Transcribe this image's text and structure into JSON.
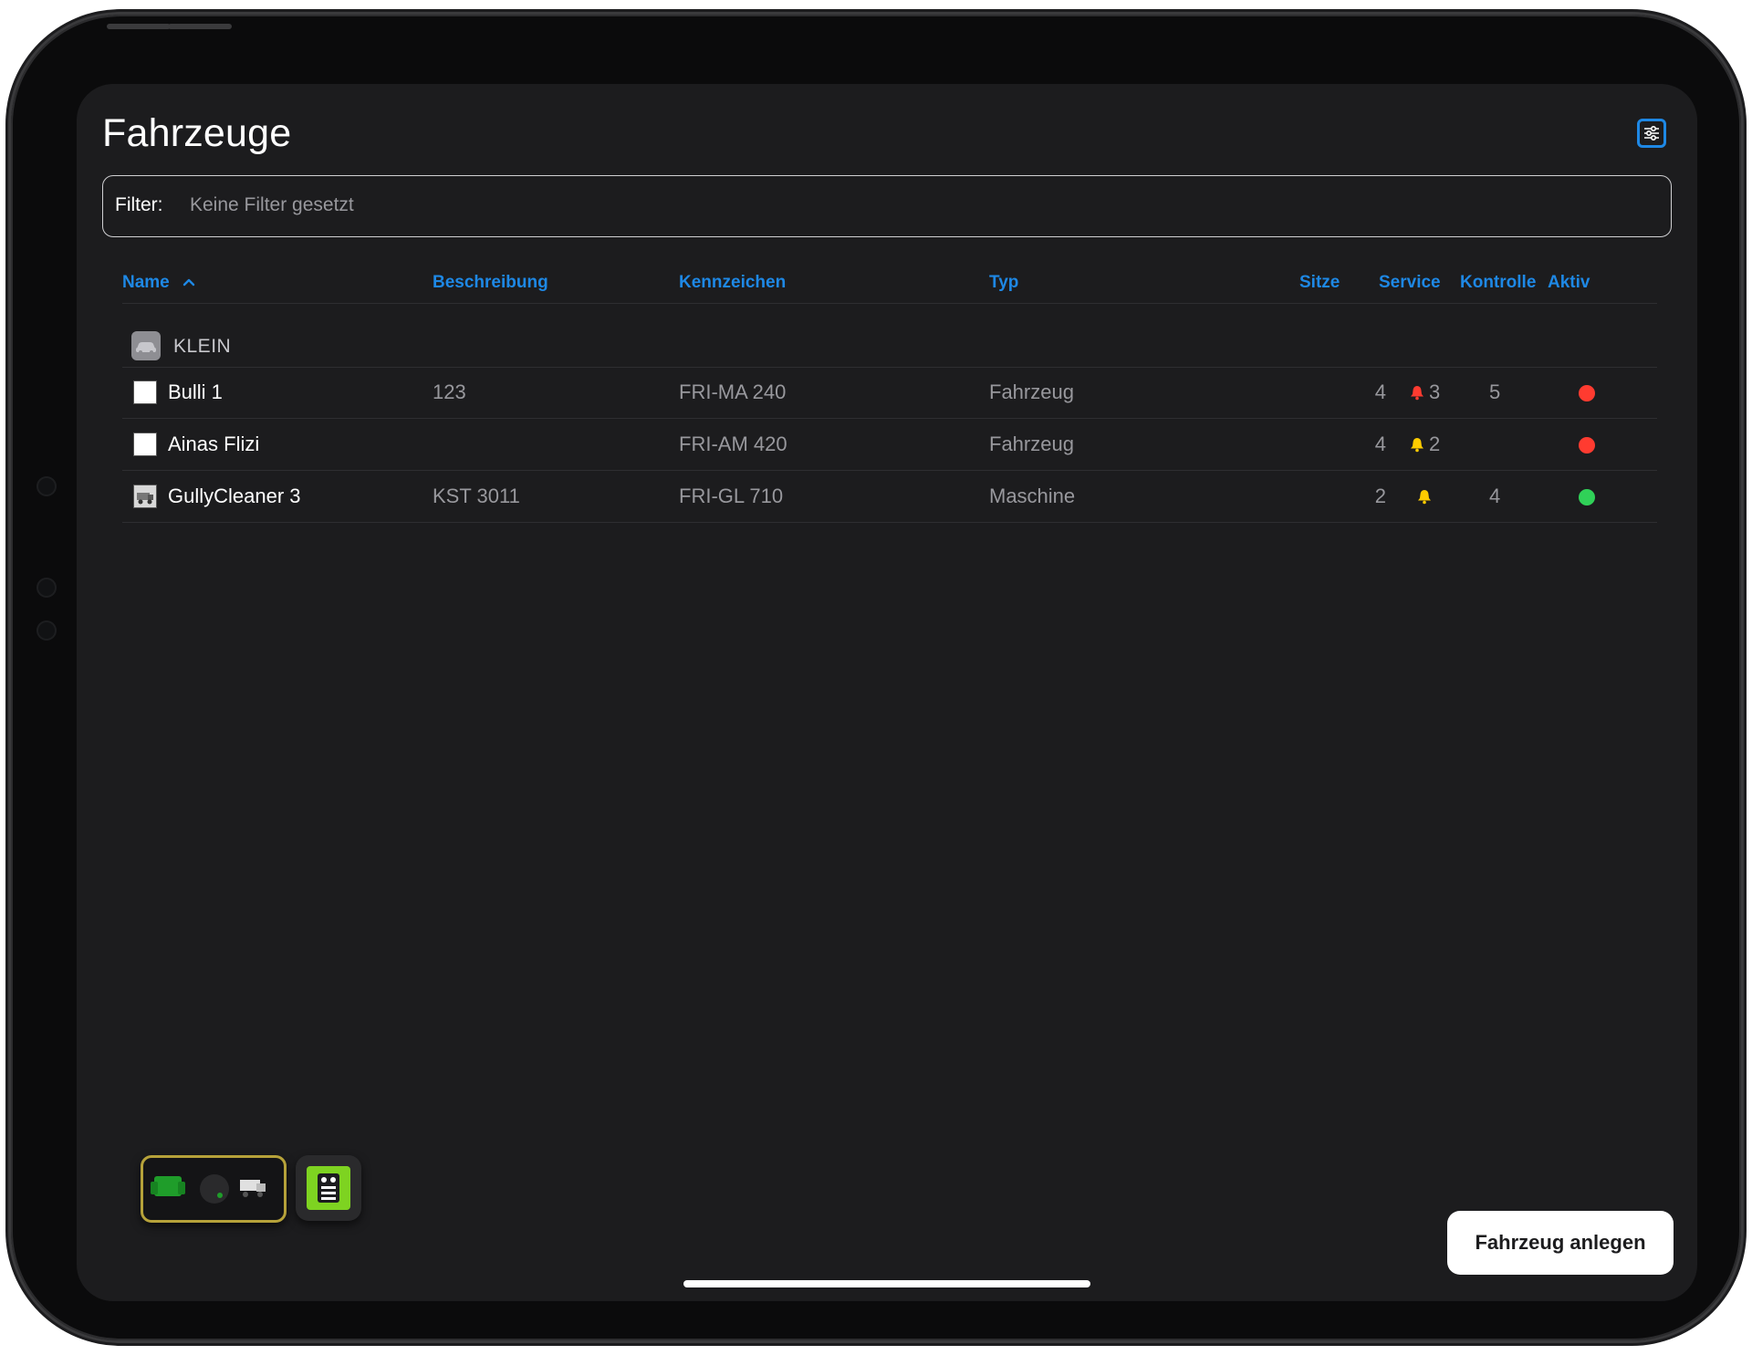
{
  "header": {
    "title": "Fahrzeuge"
  },
  "filter": {
    "label": "Filter:",
    "value": "Keine Filter gesetzt"
  },
  "columns": {
    "name": "Name",
    "description": "Beschreibung",
    "plate": "Kennzeichen",
    "type": "Typ",
    "seats": "Sitze",
    "service": "Service",
    "control": "Kontrolle",
    "active": "Aktiv"
  },
  "group": {
    "label": "KLEIN"
  },
  "rows": [
    {
      "name": "Bulli 1",
      "description": "123",
      "plate": "FRI-MA 240",
      "type": "Fahrzeug",
      "seats": "4",
      "service": "3",
      "service_color": "#ff3b30",
      "control": "5",
      "active_color": "#ff3b30"
    },
    {
      "name": "Ainas Flizi",
      "description": "",
      "plate": "FRI-AM 420",
      "type": "Fahrzeug",
      "seats": "4",
      "service": "2",
      "service_color": "#ffcc00",
      "control": "",
      "active_color": "#ff3b30"
    },
    {
      "name": "GullyCleaner 3",
      "description": "KST 3011",
      "plate": "FRI-GL 710",
      "type": "Maschine",
      "seats": "2",
      "service": "",
      "service_color": "#ffcc00",
      "control": "4",
      "active_color": "#30d158"
    }
  ],
  "actions": {
    "add_vehicle": "Fahrzeug anlegen"
  },
  "colors": {
    "accent": "#1e88e5",
    "background": "#1c1c1e"
  }
}
